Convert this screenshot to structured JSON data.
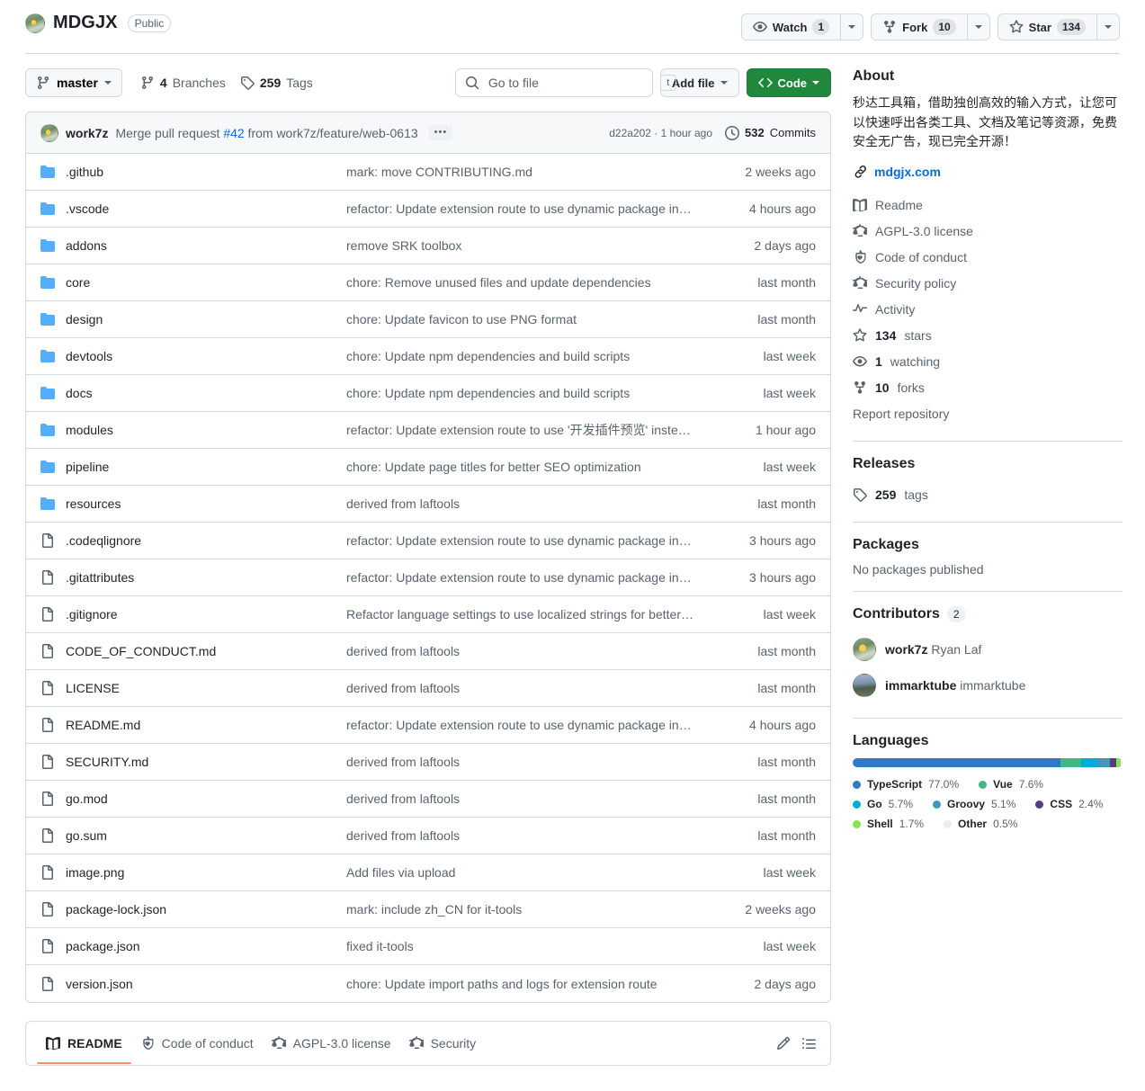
{
  "header": {
    "repo_name": "MDGJX",
    "visibility": "Public",
    "watch_label": "Watch",
    "watch_count": "1",
    "fork_label": "Fork",
    "fork_count": "10",
    "star_label": "Star",
    "star_count": "134"
  },
  "toolbar": {
    "branch": "master",
    "branches_count": "4",
    "branches_label": "Branches",
    "tags_count": "259",
    "tags_label": "Tags",
    "search_placeholder": "Go to file",
    "search_value": "",
    "search_kbd": "t",
    "add_file_label": "Add file",
    "code_label": "Code"
  },
  "commit": {
    "author": "work7z",
    "message_prefix": "Merge pull request ",
    "pr_number": "#42",
    "message_suffix": " from work7z/feature/web-0613",
    "expand_label": "•••",
    "sha": "d22a202",
    "relative_time": "1 hour ago",
    "commits_count": "532",
    "commits_label": "Commits"
  },
  "files": [
    {
      "type": "dir",
      "name": ".github",
      "message": "mark: move CONTRIBUTING.md",
      "age": "2 weeks ago"
    },
    {
      "type": "dir",
      "name": ".vscode",
      "message": "refactor: Update extension route to use dynamic package inf…",
      "age": "4 hours ago"
    },
    {
      "type": "dir",
      "name": "addons",
      "message": "remove SRK toolbox",
      "age": "2 days ago"
    },
    {
      "type": "dir",
      "name": "core",
      "message": "chore: Remove unused files and update dependencies",
      "age": "last month"
    },
    {
      "type": "dir",
      "name": "design",
      "message": "chore: Update favicon to use PNG format",
      "age": "last month"
    },
    {
      "type": "dir",
      "name": "devtools",
      "message": "chore: Update npm dependencies and build scripts",
      "age": "last week"
    },
    {
      "type": "dir",
      "name": "docs",
      "message": "chore: Update npm dependencies and build scripts",
      "age": "last week"
    },
    {
      "type": "dir",
      "name": "modules",
      "message": "refactor: Update extension route to use '开发插件预览' inste…",
      "age": "1 hour ago"
    },
    {
      "type": "dir",
      "name": "pipeline",
      "message": "chore: Update page titles for better SEO optimization",
      "age": "last week"
    },
    {
      "type": "dir",
      "name": "resources",
      "message": "derived from laftools",
      "age": "last month"
    },
    {
      "type": "file",
      "name": ".codeqlignore",
      "message": "refactor: Update extension route to use dynamic package inf…",
      "age": "3 hours ago"
    },
    {
      "type": "file",
      "name": ".gitattributes",
      "message": "refactor: Update extension route to use dynamic package inf…",
      "age": "3 hours ago"
    },
    {
      "type": "file",
      "name": ".gitignore",
      "message": "Refactor language settings to use localized strings for better…",
      "age": "last week"
    },
    {
      "type": "file",
      "name": "CODE_OF_CONDUCT.md",
      "message": "derived from laftools",
      "age": "last month"
    },
    {
      "type": "file",
      "name": "LICENSE",
      "message": "derived from laftools",
      "age": "last month"
    },
    {
      "type": "file",
      "name": "README.md",
      "message": "refactor: Update extension route to use dynamic package inf…",
      "age": "4 hours ago"
    },
    {
      "type": "file",
      "name": "SECURITY.md",
      "message": "derived from laftools",
      "age": "last month"
    },
    {
      "type": "file",
      "name": "go.mod",
      "message": "derived from laftools",
      "age": "last month"
    },
    {
      "type": "file",
      "name": "go.sum",
      "message": "derived from laftools",
      "age": "last month"
    },
    {
      "type": "file",
      "name": "image.png",
      "message": "Add files via upload",
      "age": "last week"
    },
    {
      "type": "file",
      "name": "package-lock.json",
      "message": "mark: include zh_CN for it-tools",
      "age": "2 weeks ago"
    },
    {
      "type": "file",
      "name": "package.json",
      "message": "fixed it-tools",
      "age": "last week"
    },
    {
      "type": "file",
      "name": "version.json",
      "message": "chore: Update import paths and logs for extension route",
      "age": "2 days ago"
    }
  ],
  "readme_tabs": [
    {
      "label": "README",
      "icon": "book-icon",
      "active": true
    },
    {
      "label": "Code of conduct",
      "icon": "shield-heart-icon",
      "active": false
    },
    {
      "label": "AGPL-3.0 license",
      "icon": "law-icon",
      "active": false
    },
    {
      "label": "Security",
      "icon": "law-icon",
      "active": false
    }
  ],
  "readme_tools": {
    "edit": "pencil-icon",
    "outline": "list-icon"
  },
  "about": {
    "title": "About",
    "description": "秒达工具箱，借助独创高效的输入方式，让您可以快速呼出各类工具、文档及笔记等资源，免费安全无广告，现已完全开源！",
    "homepage": "mdgjx.com",
    "links": [
      {
        "icon": "book-icon",
        "label": "Readme"
      },
      {
        "icon": "law-icon",
        "label": "AGPL-3.0 license"
      },
      {
        "icon": "shield-heart-icon",
        "label": "Code of conduct"
      },
      {
        "icon": "law-icon",
        "label": "Security policy"
      },
      {
        "icon": "pulse-icon",
        "label": "Activity"
      }
    ],
    "stats": [
      {
        "icon": "star-icon",
        "count": "134",
        "label": "stars"
      },
      {
        "icon": "eye-icon",
        "count": "1",
        "label": "watching"
      },
      {
        "icon": "fork-icon",
        "count": "10",
        "label": "forks"
      }
    ],
    "report": "Report repository"
  },
  "releases": {
    "title": "Releases",
    "tags_count": "259",
    "tags_label": "tags"
  },
  "packages": {
    "title": "Packages",
    "empty": "No packages published"
  },
  "contributors": {
    "title": "Contributors",
    "count": "2",
    "people": [
      {
        "username": "work7z",
        "name": "Ryan Laf"
      },
      {
        "username": "immarktube",
        "name": "immarktube"
      }
    ]
  },
  "languages": {
    "title": "Languages",
    "items": [
      {
        "name": "TypeScript",
        "percent": "77.0%",
        "value": 77.0,
        "color": "#3178c6"
      },
      {
        "name": "Vue",
        "percent": "7.6%",
        "value": 7.6,
        "color": "#41b883"
      },
      {
        "name": "Go",
        "percent": "5.7%",
        "value": 5.7,
        "color": "#00add8"
      },
      {
        "name": "Groovy",
        "percent": "5.1%",
        "value": 5.1,
        "color": "#4298b8"
      },
      {
        "name": "CSS",
        "percent": "2.4%",
        "value": 2.4,
        "color": "#563d7c"
      },
      {
        "name": "Shell",
        "percent": "1.7%",
        "value": 1.7,
        "color": "#89e051"
      },
      {
        "name": "Other",
        "percent": "0.5%",
        "value": 0.5,
        "color": "#ededed"
      }
    ]
  }
}
